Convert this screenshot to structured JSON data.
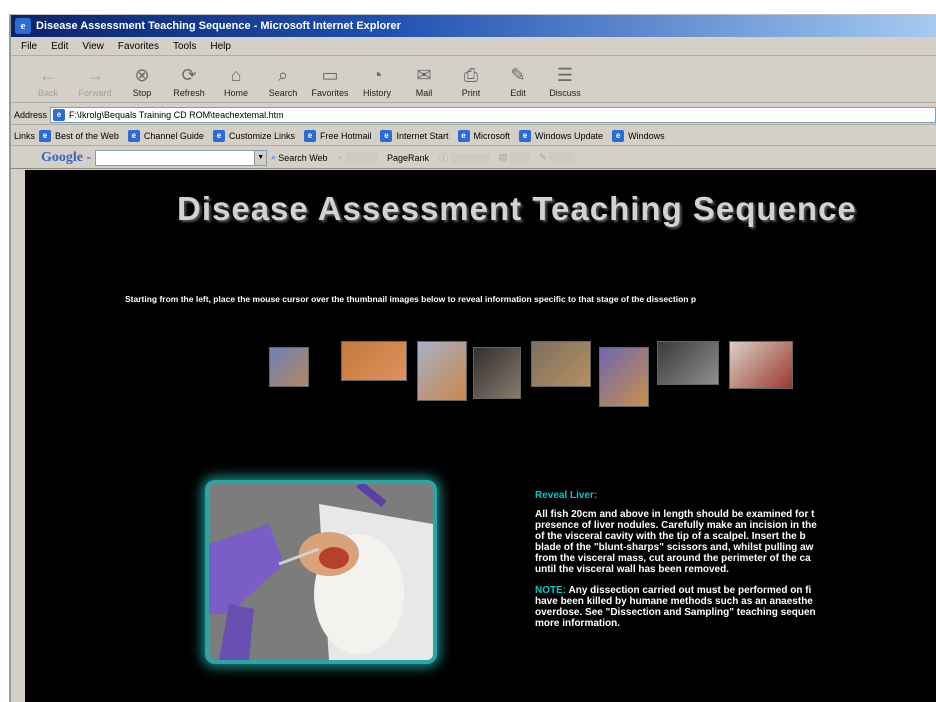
{
  "window": {
    "title": "Disease Assessment Teaching Sequence - Microsoft Internet Explorer"
  },
  "menu": [
    "File",
    "Edit",
    "View",
    "Favorites",
    "Tools",
    "Help"
  ],
  "toolbar": [
    {
      "label": "Back",
      "icon": "back-arrow-icon",
      "enabled": false
    },
    {
      "label": "Forward",
      "icon": "forward-arrow-icon",
      "enabled": false
    },
    {
      "label": "Stop",
      "icon": "stop-icon",
      "enabled": true
    },
    {
      "label": "Refresh",
      "icon": "refresh-icon",
      "enabled": true
    },
    {
      "label": "Home",
      "icon": "home-icon",
      "enabled": true
    },
    {
      "label": "Search",
      "icon": "search-icon",
      "enabled": true
    },
    {
      "label": "Favorites",
      "icon": "favorites-icon",
      "enabled": true
    },
    {
      "label": "History",
      "icon": "history-icon",
      "enabled": true
    },
    {
      "label": "Mail",
      "icon": "mail-icon",
      "enabled": true
    },
    {
      "label": "Print",
      "icon": "print-icon",
      "enabled": true
    },
    {
      "label": "Edit",
      "icon": "edit-icon",
      "enabled": true
    },
    {
      "label": "Discuss",
      "icon": "discuss-icon",
      "enabled": true
    }
  ],
  "address": {
    "label": "Address",
    "value": "F:\\Ikrolg\\Bequals Training CD ROM\\teachextemal.htm"
  },
  "links": {
    "label": "Links",
    "items": [
      "Best of the Web",
      "Channel Guide",
      "Customize Links",
      "Free Hotmail",
      "Internet Start",
      "Microsoft",
      "Windows Update",
      "Windows"
    ]
  },
  "google": {
    "logo": "Google -",
    "search_web": "Search Web",
    "pagerank": "PageRank"
  },
  "page": {
    "heading": "Disease Assessment Teaching Sequence",
    "instructions": "Starting from the left, place the mouse cursor over the thumbnail images below to reveal information specific to that stage of the dissection p",
    "thumbnails": [
      {
        "name": "thumb-1",
        "colors": [
          "#6e7fb8",
          "#b08a5c"
        ]
      },
      {
        "name": "thumb-2",
        "colors": [
          "#c47a3a",
          "#e09060"
        ]
      },
      {
        "name": "thumb-3",
        "colors": [
          "#a7b0c8",
          "#c8884a"
        ]
      },
      {
        "name": "thumb-4",
        "colors": [
          "#303030",
          "#8a7a6a"
        ]
      },
      {
        "name": "thumb-5",
        "colors": [
          "#7a6f66",
          "#b8905c"
        ]
      },
      {
        "name": "thumb-6",
        "colors": [
          "#6f67b0",
          "#c8904a"
        ]
      },
      {
        "name": "thumb-7",
        "colors": [
          "#3a3a3a",
          "#8f8f8f"
        ]
      },
      {
        "name": "thumb-8",
        "colors": [
          "#d9d0c6",
          "#9a3a2a"
        ]
      }
    ],
    "info": {
      "heading": "Reveal Liver:",
      "body": [
        "All fish 20cm and above in length should be examined for t",
        "presence of liver nodules. Carefully make an incision in the",
        "of the visceral cavity with the tip of a scalpel. Insert the b",
        "blade of the \"blunt-sharps\" scissors and, whilst pulling aw",
        "from the visceral mass, cut around the perimeter of the ca",
        "until the visceral wall has been removed."
      ],
      "note_label": "NOTE:",
      "note_lines": [
        " Any dissection carried out must be performed on fi",
        "have been killed by humane methods such as an anaesthe",
        "overdose. See \"Dissection and Sampling\" teaching sequen",
        "more information."
      ]
    }
  },
  "colors": {
    "title_bar": "#0a246a",
    "page_bg": "#000000",
    "accent_cyan": "#00c8c8",
    "image_border": "#2aa6a6"
  }
}
